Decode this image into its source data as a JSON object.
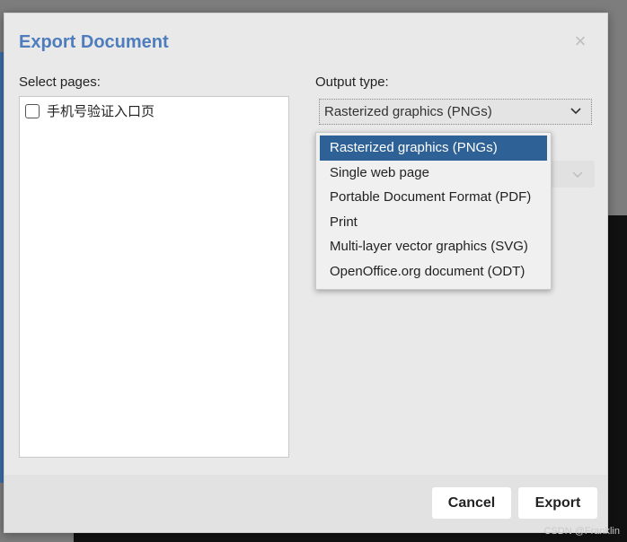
{
  "dialog": {
    "title": "Export Document",
    "close_glyph": "×"
  },
  "pages": {
    "label": "Select pages:",
    "items": [
      {
        "label": "手机号验证入口页",
        "checked": false
      }
    ]
  },
  "output": {
    "label": "Output type:",
    "selected": "Rasterized graphics (PNGs)",
    "options": [
      "Rasterized graphics (PNGs)",
      "Single web page",
      "Portable Document Format (PDF)",
      "Print",
      "Multi-layer vector graphics (SVG)",
      "OpenOffice.org document (ODT)"
    ]
  },
  "buttons": {
    "cancel": "Cancel",
    "export": "Export"
  },
  "watermark": "CSDN @Franklin",
  "colors": {
    "title": "#4e7dbd",
    "selected_option": "#2e6196"
  }
}
